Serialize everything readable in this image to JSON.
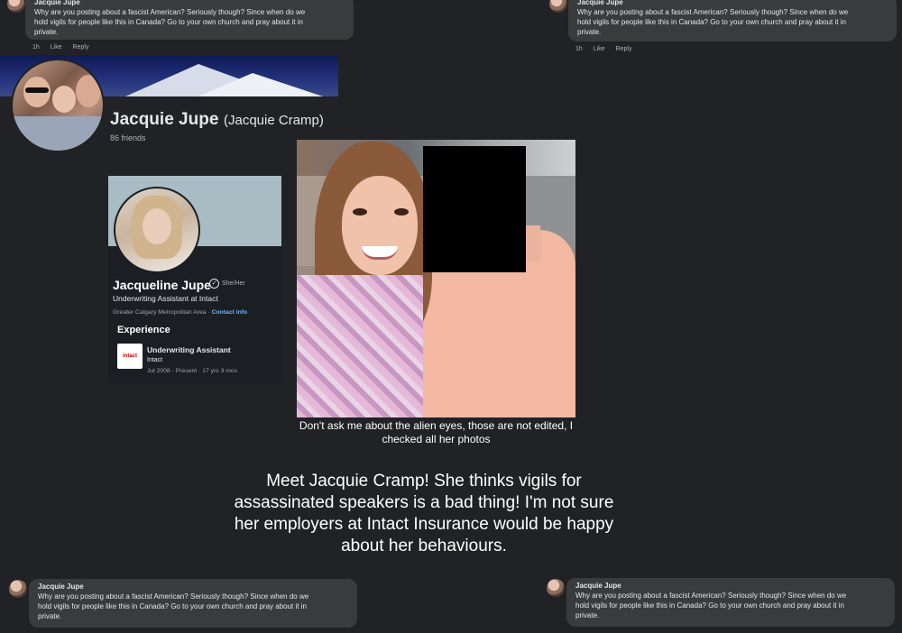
{
  "comment": {
    "author": "Jacquie Jupe",
    "line1": "Why are you posting about a fascist American? Seriously though? Since when do we",
    "line2": "hold vigils for people like this in Canada? Go to your own church and pray about it in",
    "line3": "private.",
    "time": "1h",
    "like": "Like",
    "reply": "Reply"
  },
  "profile": {
    "name": "Jacquie Jupe",
    "alt_name": "(Jacquie Cramp)",
    "friends": "86 friends"
  },
  "linkedin": {
    "name": "Jacqueline Jupe",
    "pronouns": "She/Her",
    "headline": "Underwriting Assistant at Intact",
    "location": "Greater Calgary Metropolitan Area · ",
    "contact": "Contact info",
    "experience_title": "Experience",
    "logo_text": "intact",
    "job_title": "Underwriting Assistant",
    "company": "Intact",
    "dates": "Jul 2008 - Present · 17 yrs 3 mos"
  },
  "photo_caption": "Don't ask me about the alien eyes, those are not edited, I checked all her photos",
  "headline": "Meet Jacquie Cramp! She thinks vigils for assassinated speakers is a bad thing! I'm not sure her employers at Intact Insurance would be happy about her behaviours."
}
